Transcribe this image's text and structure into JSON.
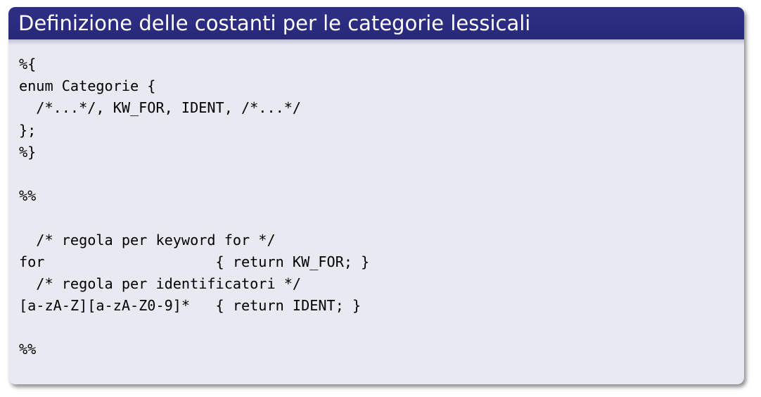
{
  "block": {
    "title": "Definizione delle costanti per le categorie lessicali"
  },
  "code_lines": [
    "%{",
    "enum Categorie {",
    "  /*...*/, KW_FOR, IDENT, /*...*/",
    "};",
    "%}",
    "",
    "%%",
    "",
    "  /* regola per keyword for */",
    "for                    { return KW_FOR; }",
    "  /* regola per identificatori */",
    "[a-zA-Z][a-zA-Z0-9]*   { return IDENT; }",
    "",
    "%%"
  ],
  "colors": {
    "title_bar": "#2b2b7e",
    "title_text": "#ffffff",
    "body_background": "#e9e9f1",
    "code_text": "#000000"
  }
}
